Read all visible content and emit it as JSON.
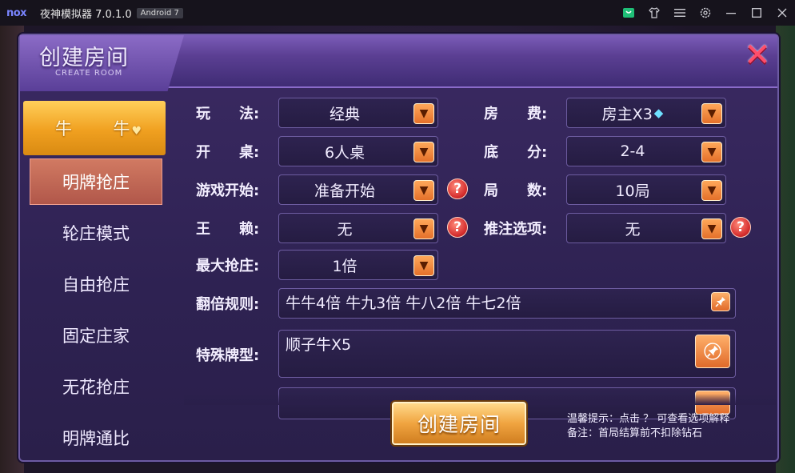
{
  "emulator": {
    "logo": "nox",
    "title": "夜神模拟器 7.0.1.0",
    "android_badge": "Android 7",
    "icons": [
      "store-icon",
      "shirt-icon",
      "menu-icon",
      "settings-icon",
      "minimize-icon",
      "maximize-icon",
      "close-icon"
    ]
  },
  "dialog": {
    "title": "创建房间",
    "subtitle": "CREATE ROOM",
    "close_glyph": "✕"
  },
  "sidebar": {
    "category": {
      "left": "牛",
      "right": "牛"
    },
    "items": [
      "明牌抢庄",
      "轮庄模式",
      "自由抢庄",
      "固定庄家",
      "无花抢庄",
      "明牌通比"
    ],
    "active_index": 0
  },
  "form": {
    "play_label": "玩　　法:",
    "play_value": "经典",
    "fee_label": "房　　费:",
    "fee_value": "房主X3",
    "table_label": "开　　桌:",
    "table_value": "6人桌",
    "score_label": "底　　分:",
    "score_value": "2-4",
    "start_label": "游戏开始:",
    "start_value": "准备开始",
    "rounds_label": "局　　数:",
    "rounds_value": "10局",
    "wild_label": "王　　赖:",
    "wild_value": "无",
    "push_label": "推注选项:",
    "push_value": "无",
    "maxbank_label": "最大抢庄:",
    "maxbank_value": "1倍",
    "double_label": "翻倍规则:",
    "double_value": "牛牛4倍 牛九3倍 牛八2倍 牛七2倍",
    "special_label": "特殊牌型:",
    "special_value": "顺子牛X5",
    "help_glyph": "?"
  },
  "footer": {
    "create_button": "创建房间",
    "tip_line1": "温馨提示：点击 ？ 可查看选项解释",
    "tip_line2": "备注：首局结算前不扣除钻石"
  },
  "colors": {
    "accent_orange": "#e4702a",
    "dialog_purple": "#2e2252",
    "active_item": "#b1574a"
  }
}
